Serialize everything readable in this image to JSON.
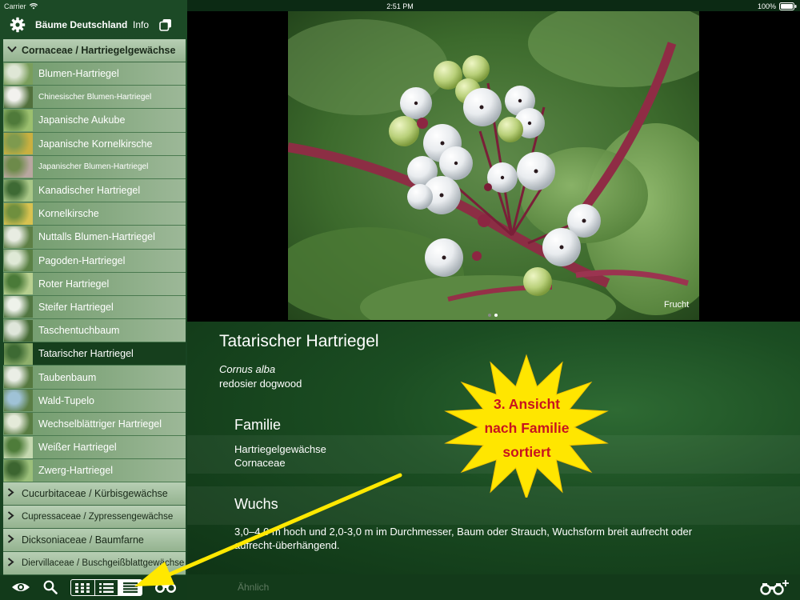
{
  "status": {
    "carrier": "Carrier",
    "time": "2:51 PM",
    "battery": "100%"
  },
  "header": {
    "title": "Bäume Deutschland",
    "info_label": "Info"
  },
  "list": {
    "open_family": "Cornaceae / Hartriegelgewächse",
    "items": [
      {
        "label": "Blumen-Hartriegel",
        "small": false
      },
      {
        "label": "Chinesischer Blumen-Hartriegel",
        "small": true
      },
      {
        "label": "Japanische Aukube",
        "small": false
      },
      {
        "label": "Japanische Kornelkirsche",
        "small": false
      },
      {
        "label": "Japanischer Blumen-Hartriegel",
        "small": true
      },
      {
        "label": "Kanadischer Hartriegel",
        "small": false
      },
      {
        "label": "Kornelkirsche",
        "small": false
      },
      {
        "label": "Nuttalls Blumen-Hartriegel",
        "small": false
      },
      {
        "label": "Pagoden-Hartriegel",
        "small": false
      },
      {
        "label": "Roter Hartriegel",
        "small": false
      },
      {
        "label": "Steifer Hartriegel",
        "small": false
      },
      {
        "label": "Taschentuchbaum",
        "small": false
      },
      {
        "label": "Tatarischer Hartriegel",
        "small": false,
        "selected": true
      },
      {
        "label": "Taubenbaum",
        "small": false
      },
      {
        "label": "Wald-Tupelo",
        "small": false
      },
      {
        "label": "Wechselblättriger Hartriegel",
        "small": false
      },
      {
        "label": "Weißer Hartriegel",
        "small": false
      },
      {
        "label": "Zwerg-Hartriegel",
        "small": false
      }
    ],
    "collapsed_families": [
      {
        "label": "Cucurbitaceae / Kürbisgewächse",
        "small": false
      },
      {
        "label": "Cupressaceae / Zypressengewächse",
        "small": true
      },
      {
        "label": "Dicksoniaceae / Baumfarne",
        "small": false
      },
      {
        "label": "Diervillaceae / Buschgeißblattgewächse",
        "small": true
      }
    ]
  },
  "photo": {
    "caption": "Frucht",
    "pages": 2,
    "current_page": 2
  },
  "detail": {
    "name": "Tatarischer Hartriegel",
    "latin": "Cornus alba",
    "english": "redosier dogwood",
    "sections": [
      {
        "title": "Familie",
        "lines": [
          "Hartriegelgewächse",
          "Cornaceae"
        ]
      },
      {
        "title": "Wuchs",
        "lines": [
          "3,0–4,0 m hoch und 2,0-3,0 m im Durchmesser, Baum oder Strauch, Wuchsform breit aufrecht oder",
          "aufrecht-überhängend."
        ]
      }
    ]
  },
  "annotation": {
    "lines": [
      "3. Ansicht",
      "nach Familie",
      "sortiert"
    ],
    "color": "#c8141e",
    "burst_color": "#ffe600",
    "arrow_color": "#ffe800"
  },
  "toolbar": {
    "similar_label": "Ähnlich"
  },
  "icons": [
    "gear-icon",
    "copy-icon",
    "eye-icon",
    "search-icon",
    "grid-view-icon",
    "list-view-icon",
    "family-view-icon",
    "binoculars-icon",
    "binoculars-add-icon",
    "wifi-icon",
    "battery-icon"
  ]
}
